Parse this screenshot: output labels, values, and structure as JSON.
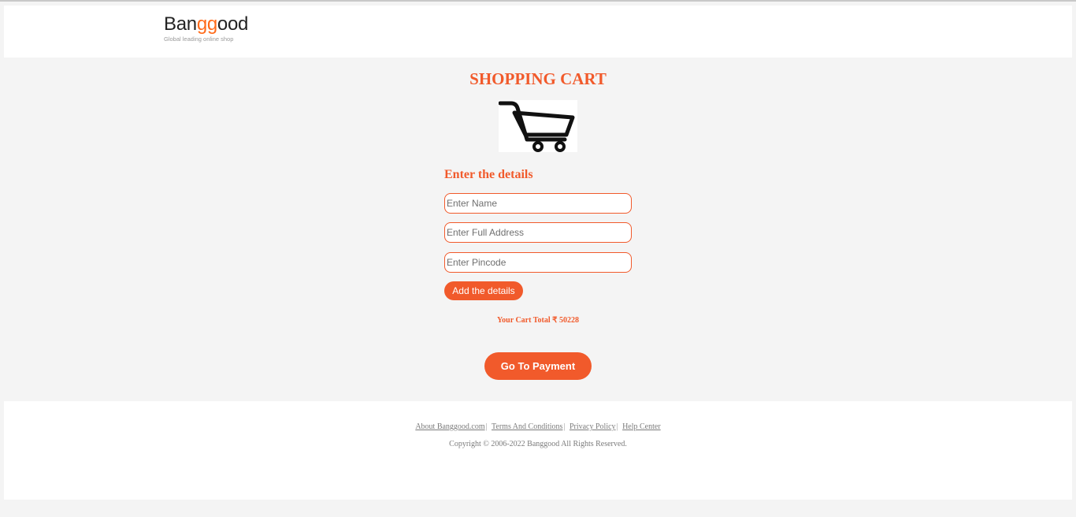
{
  "header": {
    "logo_part1": "Ban",
    "logo_part2": "gg",
    "logo_part3": "ood",
    "logo_tagline": "Global leading online shop"
  },
  "main": {
    "title": "SHOPPING CART",
    "details_heading": "Enter the details",
    "name_placeholder": "Enter Name",
    "address_placeholder": "Enter Full Address",
    "pincode_placeholder": "Enter Pincode",
    "add_button": "Add the details",
    "cart_total": "Your Cart Total ₹ 50228",
    "pay_button": "Go To Payment"
  },
  "footer": {
    "links": [
      "About Banggood.com",
      "Terms And Conditions",
      "Privacy Policy",
      "Help Center"
    ],
    "separator": "|",
    "copyright": "Copyright © 2006-2022 Banggood All Rights Reserved."
  },
  "colors": {
    "accent": "#f15a2b",
    "logo_accent": "#ff6b1a",
    "page_bg": "#f4f4f4"
  },
  "icons": [
    "shopping-cart-icon"
  ]
}
